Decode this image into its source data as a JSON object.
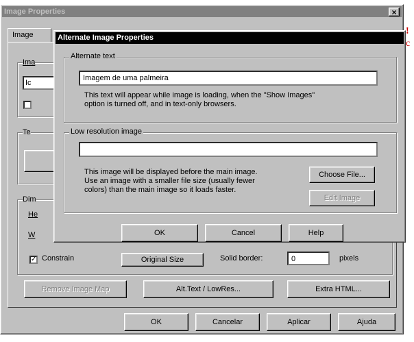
{
  "background_window": {
    "title": "Image Properties",
    "close_glyph": "×",
    "tab_image": "Image",
    "partial_labels": [
      "Ima",
      "Te",
      "Dim",
      "He",
      "W"
    ],
    "partial_value": "Ic",
    "constrain_label": "Constrain",
    "original_size_button": "Original Size",
    "solid_border_label": "Solid border:",
    "solid_border_value": "0",
    "pixels_label": "pixels",
    "remove_image_map_button": "Remove Image Map",
    "alt_text_button": "Alt.Text / LowRes...",
    "extra_html_button": "Extra HTML...",
    "ok_button": "OK",
    "cancel_button": "Cancelar",
    "apply_button": "Aplicar",
    "help_button": "Ajuda"
  },
  "dialog": {
    "title": "Alternate Image Properties",
    "alternate_text_group": "Alternate text",
    "alternate_text_value": "Imagem de uma palmeira",
    "alternate_text_note_1": "This text will appear while image is loading, when the \"Show Images\"",
    "alternate_text_note_2": "option is turned off, and in text-only browsers.",
    "low_res_group": "Low resolution image",
    "low_res_value": "",
    "low_res_note_1": "This image will be displayed before the main image.",
    "low_res_note_2": "Use an image with a smaller file size (usually fewer",
    "low_res_note_3": "colors) than the main image so it loads faster.",
    "choose_file_button": "Choose File...",
    "edit_image_button": "Edit Image",
    "ok_button": "OK",
    "cancel_button": "Cancel",
    "help_button": "Help"
  },
  "edge_glyphs": [
    "!",
    "c"
  ]
}
